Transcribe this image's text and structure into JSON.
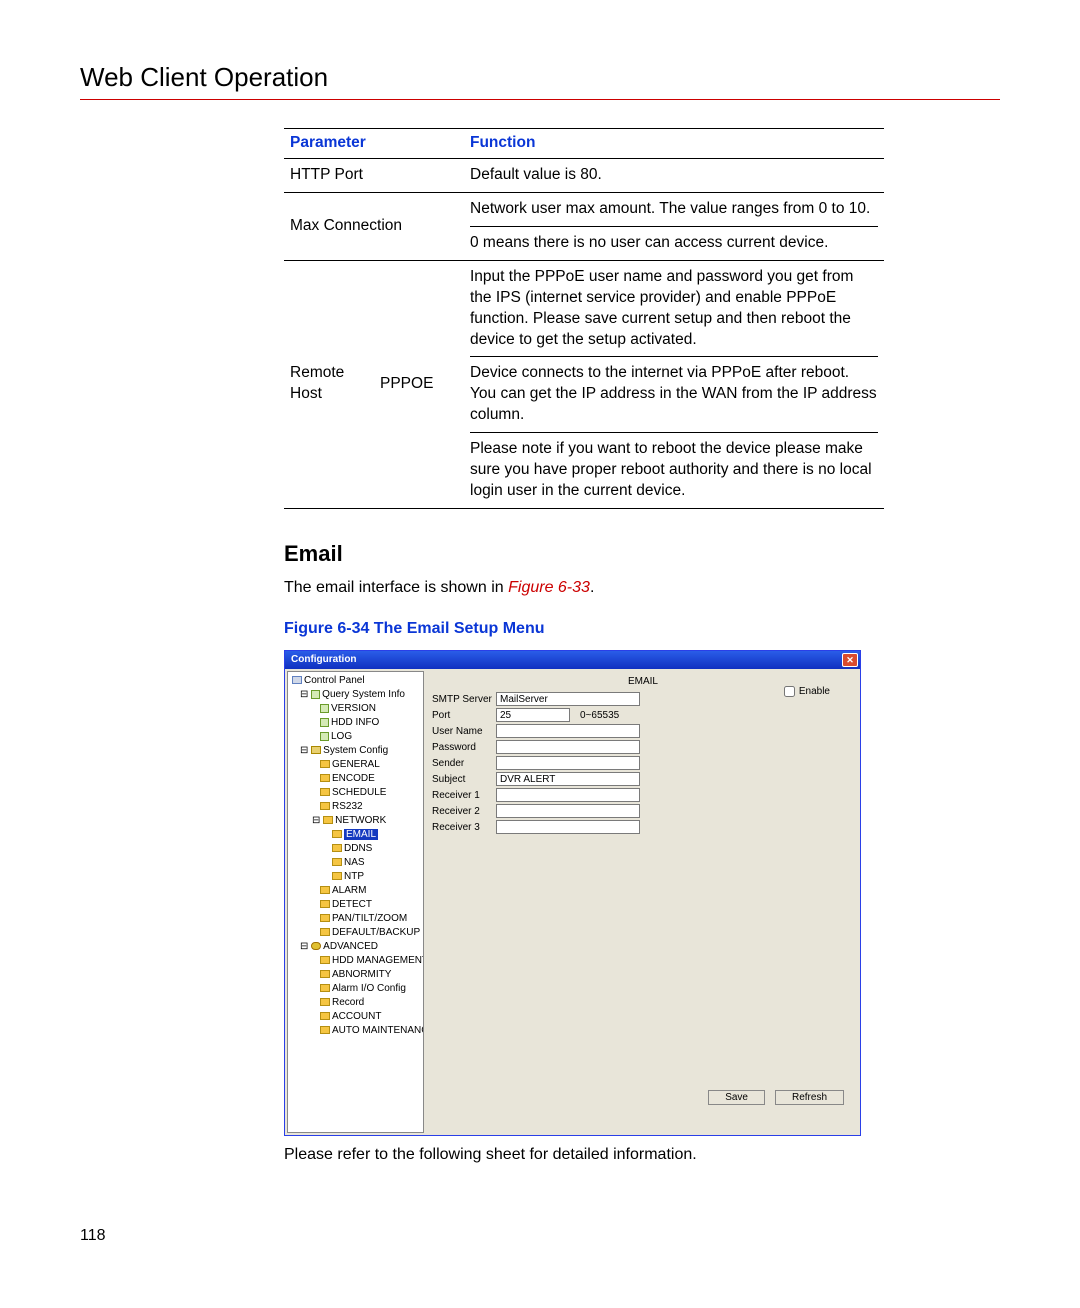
{
  "page": {
    "title": "Web Client Operation",
    "number": "118"
  },
  "table": {
    "headers": {
      "param": "Parameter",
      "func": "Function"
    },
    "rows": [
      {
        "param": "HTTP  Port",
        "func": "Default value is 80."
      },
      {
        "param": "Max Connection",
        "func_a": "Network user max amount. The value ranges from 0 to 10.",
        "func_b": "0 means there is no user can access current device."
      },
      {
        "param_a": "Remote Host",
        "param_b": "PPPOE",
        "func_a": "Input the PPPoE user name and password you get from the IPS (internet service provider) and enable PPPoE function. Please save current setup and then reboot the device to get the setup activated.",
        "func_b": "Device connects to the internet via PPPoE after reboot. You can get the IP address in the WAN from the IP address column.",
        "func_c": "Please note if you want to reboot the device please make sure you have proper reboot authority and there is no local login user in the current device."
      }
    ]
  },
  "section": {
    "heading": "Email",
    "intro_a": "The email interface is shown in ",
    "intro_fig": "Figure 6-33",
    "intro_b": ".",
    "caption": "Figure 6-34 The Email Setup Menu",
    "after": "Please refer to the following sheet for detailed information."
  },
  "screenshot": {
    "titlebar": "Configuration",
    "tree": {
      "root": "Control Panel",
      "group1": "Query System Info",
      "g1_items": [
        "VERSION",
        "HDD INFO",
        "LOG"
      ],
      "group2": "System Config",
      "g2_items": [
        "GENERAL",
        "ENCODE",
        "SCHEDULE",
        "RS232"
      ],
      "network": "NETWORK",
      "net_items_selected": "EMAIL",
      "net_items": [
        "DDNS",
        "NAS",
        "NTP"
      ],
      "g2_items_b": [
        "ALARM",
        "DETECT",
        "PAN/TILT/ZOOM",
        "DEFAULT/BACKUP"
      ],
      "group3": "ADVANCED",
      "g3_items": [
        "HDD MANAGEMENT",
        "ABNORMITY",
        "Alarm I/O Config",
        "Record",
        "ACCOUNT",
        "AUTO MAINTENANCE"
      ]
    },
    "main": {
      "heading": "EMAIL",
      "enable": "Enable",
      "labels": {
        "smtp": "SMTP Server",
        "port": "Port",
        "port_hint": "0~65535",
        "user": "User Name",
        "pass": "Password",
        "sender": "Sender",
        "subject": "Subject",
        "r1": "Receiver 1",
        "r2": "Receiver 2",
        "r3": "Receiver 3"
      },
      "values": {
        "smtp": "MailServer",
        "port": "25",
        "subject": "DVR ALERT"
      },
      "buttons": {
        "save": "Save",
        "refresh": "Refresh"
      }
    }
  }
}
